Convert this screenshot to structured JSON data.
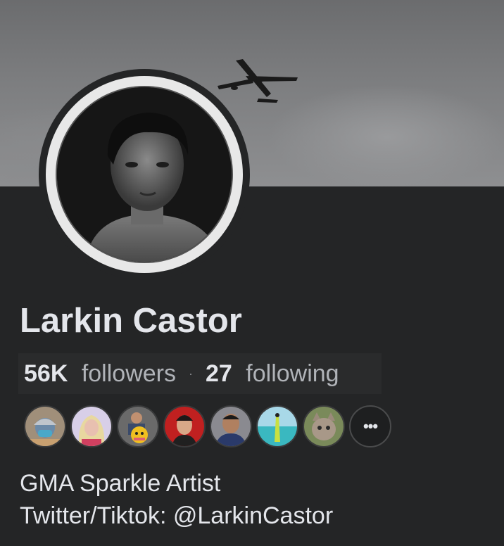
{
  "profile": {
    "name": "Larkin Castor",
    "followers_count": "56K",
    "followers_label": "followers",
    "following_count": "27",
    "following_label": "following",
    "separator": "·"
  },
  "friends": [
    {
      "name": "friend-avatar-1",
      "color": "#7a8a95"
    },
    {
      "name": "friend-avatar-2",
      "color": "#c9b28f"
    },
    {
      "name": "friend-avatar-3",
      "color": "#8a7a5a"
    },
    {
      "name": "friend-avatar-4",
      "color": "#b82a2a"
    },
    {
      "name": "friend-avatar-5",
      "color": "#4a5a8a"
    },
    {
      "name": "friend-avatar-6",
      "color": "#5ab8c8"
    },
    {
      "name": "friend-avatar-7",
      "color": "#7d8a5a"
    }
  ],
  "more_label": "•••",
  "bio": {
    "line1": "GMA Sparkle Artist",
    "line2": "Twitter/Tiktok: @LarkinCastor"
  },
  "colors": {
    "background": "#242526",
    "text_primary": "#e4e6eb",
    "text_secondary": "#b0b3b8"
  }
}
